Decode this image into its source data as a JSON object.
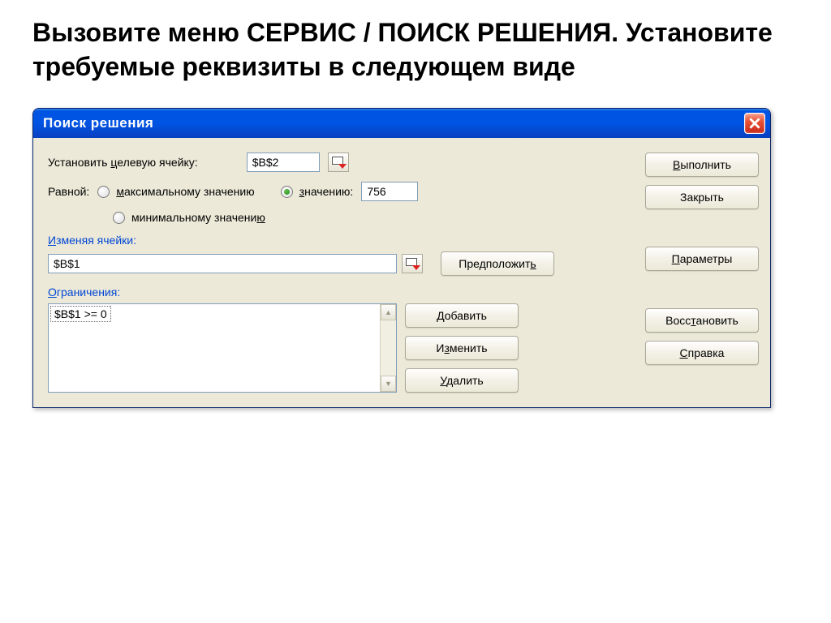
{
  "instruction": "Вызовите меню СЕРВИС / ПОИСК РЕШЕНИЯ. Установите требуемые реквизиты в следующем виде",
  "dialog": {
    "title": "Поиск решения",
    "target_label_pre": "Установить ",
    "target_label_u": "ц",
    "target_label_post": "елевую ячейку:",
    "target_value": "$B$2",
    "equal_label": "Равной:",
    "radio_max_u": "м",
    "radio_max_post": "аксимальному значению",
    "radio_val_u": "з",
    "radio_val_post": "начению:",
    "value_input": "756",
    "radio_min_pre": "минимальному значени",
    "radio_min_u": "ю",
    "changing_label_u": "И",
    "changing_label_post": "зменяя ячейки:",
    "changing_value": "$B$1",
    "constraints_label_u": "О",
    "constraints_label_post": "граничения:",
    "constraint_item": "$B$1 >= 0",
    "buttons": {
      "suggest_pre": "Предположит",
      "suggest_u": "ь",
      "add_u": "Д",
      "add_post": "обавить",
      "change_pre": "И",
      "change_u": "з",
      "change_post": "менить",
      "delete_u": "У",
      "delete_post": "далить",
      "execute_u": "В",
      "execute_post": "ыполнить",
      "close": "Закрыть",
      "params_u": "П",
      "params_post": "араметры",
      "restore_pre": "Восс",
      "restore_u": "т",
      "restore_post": "ановить",
      "help_u": "С",
      "help_post": "правка"
    }
  }
}
